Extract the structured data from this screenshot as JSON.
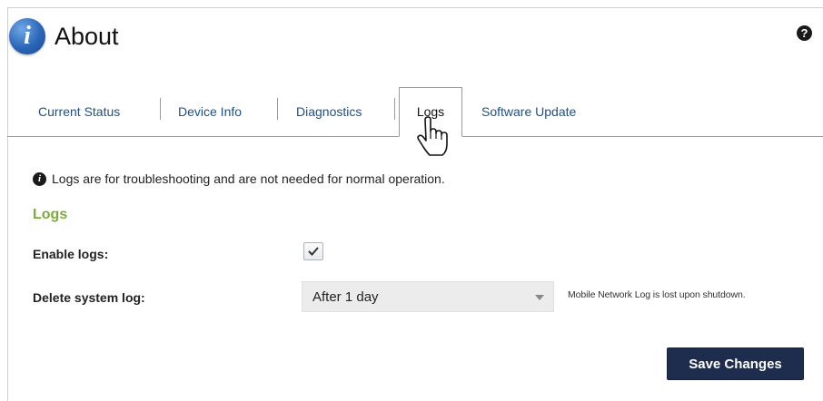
{
  "header": {
    "title": "About",
    "info_icon_glyph": "i",
    "help_icon_glyph": "?"
  },
  "tabs": [
    {
      "label": "Current Status",
      "active": false
    },
    {
      "label": "Device Info",
      "active": false
    },
    {
      "label": "Diagnostics",
      "active": false
    },
    {
      "label": "Logs",
      "active": true
    },
    {
      "label": "Software Update",
      "active": false
    }
  ],
  "notice": {
    "icon_glyph": "i",
    "text": "Logs are for troubleshooting and are not needed for normal operation."
  },
  "section": {
    "title": "Logs"
  },
  "form": {
    "enable_logs": {
      "label": "Enable logs:",
      "checked": true
    },
    "delete_log": {
      "label": "Delete system log:",
      "value": "After 1 day",
      "note": "Mobile Network Log is lost upon shutdown."
    }
  },
  "actions": {
    "save_label": "Save Changes"
  },
  "colors": {
    "section_title": "#7bab3a",
    "tab_link": "#1f4f86",
    "button_bg": "#1e2d4d"
  }
}
